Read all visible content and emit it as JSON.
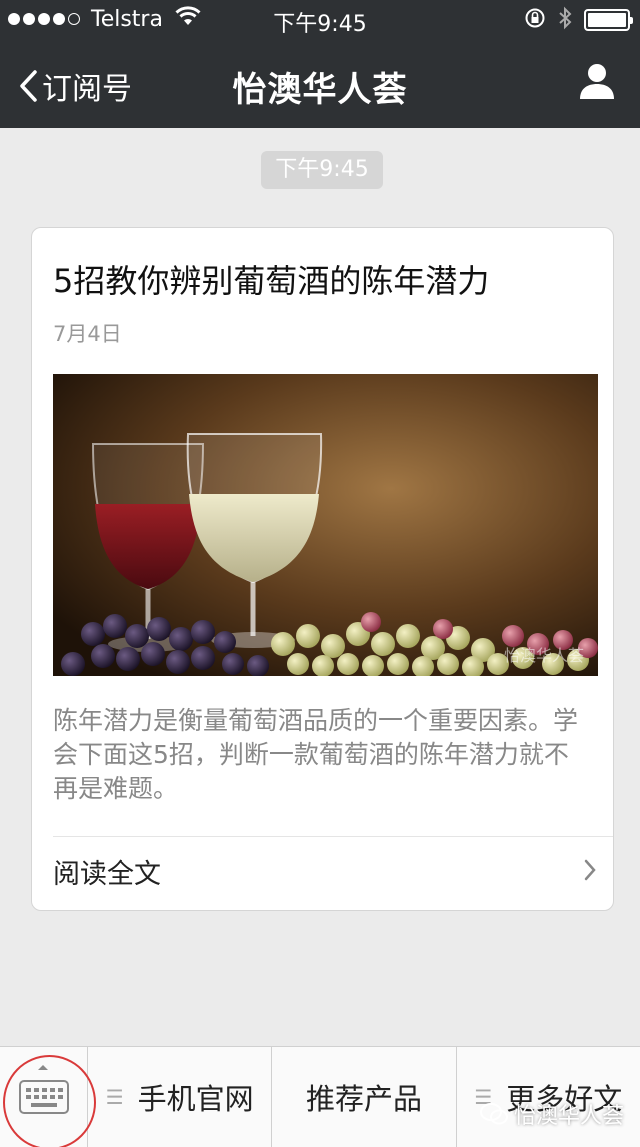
{
  "status_bar": {
    "carrier": "Telstra",
    "time": "下午9:45",
    "signal_bars_filled": 4,
    "signal_bars_total": 5,
    "battery_level": 1.0
  },
  "nav": {
    "back_label": "订阅号",
    "title": "怡澳华人荟"
  },
  "timestamp": "下午9:45",
  "article": {
    "title": "5招教你辨别葡萄酒的陈年潜力",
    "date": "7月4日",
    "image_watermark": "怡澳华人荟",
    "description": "陈年潜力是衡量葡萄酒品质的一个重要因素。学会下面这5招，判断一款葡萄酒的陈年潜力就不再是难题。",
    "read_more": "阅读全文"
  },
  "bottom_menu": {
    "items": [
      {
        "label": "手机官网",
        "has_submenu": true
      },
      {
        "label": "推荐产品",
        "has_submenu": false
      },
      {
        "label": "更多好文",
        "has_submenu": true
      }
    ]
  },
  "watermark": "怡澳华人荟",
  "colors": {
    "header_bg": "#2e3134",
    "page_bg": "#ebebeb",
    "timestamp_bg": "#d6d6d6",
    "annotation_circle": "#d93a3a"
  },
  "icons": [
    "wifi-icon",
    "lock-rotation-icon",
    "bluetooth-icon",
    "battery-icon",
    "back-chevron-icon",
    "profile-icon",
    "wine-glasses-image",
    "chevron-right-icon",
    "keyboard-icon",
    "menu-lines-icon",
    "wechat-icon"
  ]
}
